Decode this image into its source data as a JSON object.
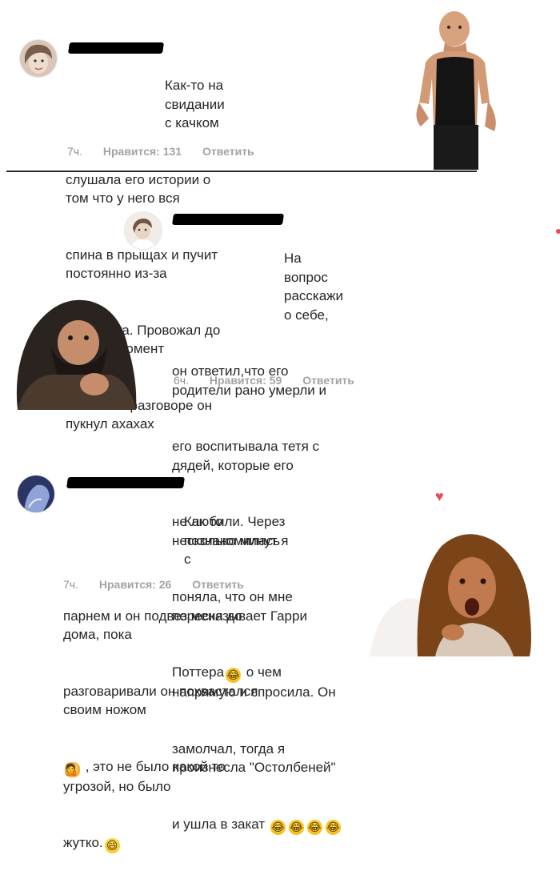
{
  "comments": [
    {
      "text_lines": [
        "Как-то на свидании с качком",
        "слушала его истории о том что у него вся",
        "спина в прыщах и пучит постоянно из-за",
        "спортпита. Провожал до дома, в момент",
        "тишины в разговоре он пукнул ахахах"
      ],
      "time": "7ч.",
      "likes": "Нравится: 131",
      "reply": "Ответить"
    },
    {
      "text_lines": [
        "На вопрос расскажи о себе,",
        "он ответил,что его родители рано умерли и",
        "его воспитывала тетя с дядей, которые его",
        "не любили. Через несколько минут я",
        "поняла, что он мне пересказывает Гарри",
        "Поттера",
        " о чем напрямую и спросила. Он",
        "замолчал, тогда я произнесла \"Остолбеней\"",
        "и ушла в закат"
      ],
      "time": "6ч.",
      "likes": "Нравится: 59",
      "reply": "Ответить"
    },
    {
      "text_lines": [
        "Как то познакомилась с",
        "парнем и он подвез меня до дома, пока",
        "разговаривали он похвастался своим ножом",
        " , это не было какой то угрозой, но было",
        "жутко."
      ],
      "time": "7ч.",
      "likes": "Нравится: 26",
      "reply": "Ответить"
    }
  ],
  "icons": {
    "laugh_emoji": "face-with-tears-of-joy-icon",
    "grin_emoji": "grinning-face-icon",
    "woman_emoji": "woman-tipping-hand-icon",
    "heart": "heart-icon"
  },
  "colors": {
    "text": "#262626",
    "meta": "#8e8e8e",
    "heart": "#ed4956"
  }
}
